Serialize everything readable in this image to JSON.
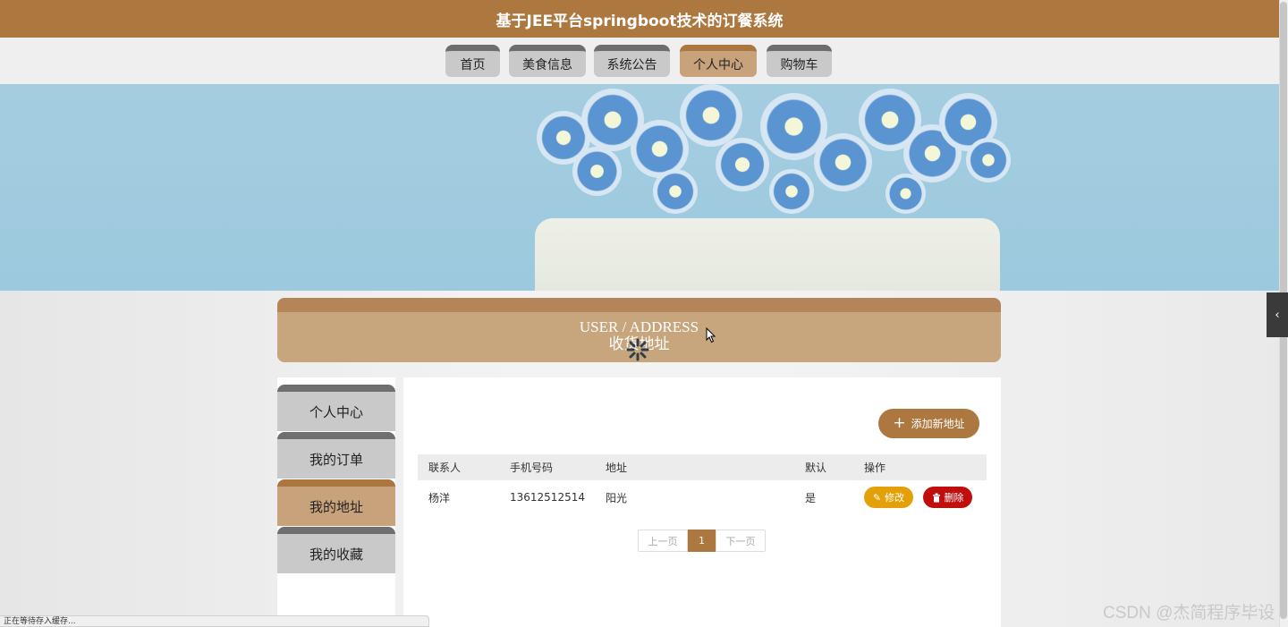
{
  "header": {
    "title": "基于JEE平台springboot技术的订餐系统"
  },
  "nav": {
    "items": [
      {
        "label": "首页",
        "active": false
      },
      {
        "label": "美食信息",
        "active": false
      },
      {
        "label": "系统公告",
        "active": false
      },
      {
        "label": "个人中心",
        "active": true
      },
      {
        "label": "购物车",
        "active": false
      }
    ]
  },
  "section": {
    "title_en": "USER / ADDRESS",
    "title_cn": "收货地址"
  },
  "sidebar": {
    "items": [
      {
        "label": "个人中心",
        "active": false
      },
      {
        "label": "我的订单",
        "active": false
      },
      {
        "label": "我的地址",
        "active": true
      },
      {
        "label": "我的收藏",
        "active": false
      }
    ]
  },
  "main": {
    "add_label": "添加新地址",
    "table": {
      "headers": [
        "联系人",
        "手机号码",
        "地址",
        "默认",
        "操作"
      ],
      "rows": [
        {
          "contact": "杨洋",
          "phone": "13612512514",
          "address": "阳光",
          "default": "是"
        }
      ]
    },
    "edit_label": "修改",
    "delete_label": "删除",
    "pager": {
      "prev": "上一页",
      "current": "1",
      "next": "下一页"
    }
  },
  "status": {
    "text": "正在等待存入缓存..."
  },
  "watermark": {
    "text": "CSDN @杰简程序毕设"
  },
  "colors": {
    "brand": "#ad7840",
    "active_tab": "#c8a27a",
    "edit": "#e3a008",
    "delete": "#c20d0d"
  }
}
